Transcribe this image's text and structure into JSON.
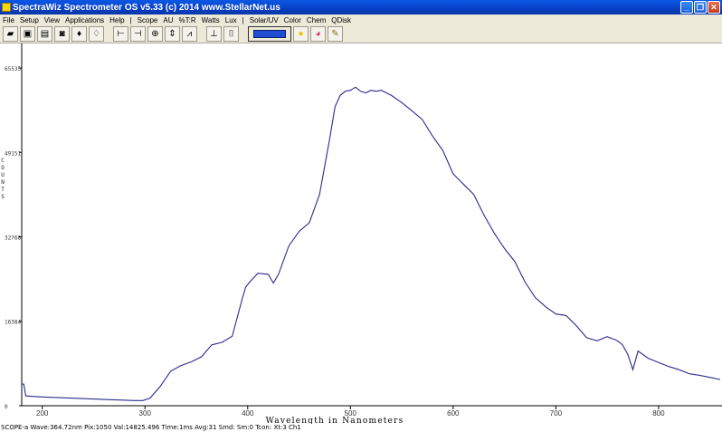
{
  "window": {
    "title": "SpectraWiz  Spectrometer OS v5.33 (c) 2014     www.StellarNet.us",
    "minimize_glyph": "_",
    "restore_glyph": "❐",
    "close_glyph": "✕"
  },
  "menu": {
    "items": [
      "File",
      "Setup",
      "View",
      "Applications",
      "Help",
      "|",
      "Scope",
      "AU",
      "%T:R",
      "Watts",
      "Lux",
      "|",
      "Solar/UV",
      "Color",
      "Chem",
      "QDisk"
    ]
  },
  "toolbar": {
    "buttons": [
      {
        "name": "open-icon",
        "glyph": "▰"
      },
      {
        "name": "save-icon",
        "glyph": "▣"
      },
      {
        "name": "print-icon",
        "glyph": "▤"
      },
      {
        "name": "camera-icon",
        "glyph": "◙"
      },
      {
        "name": "bulb-dark-icon",
        "glyph": "♦"
      },
      {
        "name": "bulb-light-icon",
        "glyph": "♢"
      },
      {
        "name": "cursor-left-icon",
        "glyph": "⊢"
      },
      {
        "name": "cursor-right-icon",
        "glyph": "⊣"
      },
      {
        "name": "zoom-icon",
        "glyph": "⊕"
      },
      {
        "name": "scale-icon",
        "glyph": "⇕"
      },
      {
        "name": "peak-icon",
        "glyph": "⩘"
      },
      {
        "name": "baseline-icon",
        "glyph": "⊥"
      },
      {
        "name": "scope-icon",
        "glyph": "⌷"
      }
    ],
    "accent_color": "#1f4fd0",
    "extra_buttons": [
      {
        "name": "yellow-circle-icon",
        "glyph": "●",
        "color": "#e7c400"
      },
      {
        "name": "color-wheel-icon",
        "glyph": "◕",
        "color": "#d0396d"
      },
      {
        "name": "paint-icon",
        "glyph": "✎",
        "color": "#8a6a1a"
      }
    ]
  },
  "chart_data": {
    "type": "line",
    "title": "",
    "xlabel": "Wavelength in Nanometers",
    "ylabel": "COUNTS",
    "xlim": [
      180,
      860
    ],
    "ylim": [
      0,
      65535
    ],
    "x_ticks": [
      200,
      300,
      400,
      500,
      600,
      700,
      800
    ],
    "y_ticks": [
      0,
      16384,
      32768,
      49151,
      65535
    ],
    "line_color": "#2b2b8f",
    "grid": false,
    "series": [
      {
        "x": [
          180,
          182,
          184,
          200,
          250,
          290,
          298,
          305,
          315,
          325,
          335,
          345,
          355,
          365,
          375,
          385,
          395,
          398,
          402,
          410,
          420,
          425,
          430,
          440,
          450,
          460,
          470,
          480,
          485,
          490,
          495,
          500,
          505,
          510,
          515,
          520,
          525,
          530,
          535,
          540,
          550,
          560,
          570,
          580,
          590,
          600,
          610,
          620,
          630,
          640,
          650,
          660,
          670,
          680,
          690,
          700,
          710,
          720,
          730,
          740,
          750,
          755,
          758,
          762,
          765,
          770,
          775,
          780,
          790,
          800,
          810,
          820,
          830,
          840,
          850,
          860
        ],
        "y": [
          4200,
          4200,
          1900,
          1700,
          1300,
          1000,
          1000,
          1500,
          3800,
          6700,
          7800,
          8500,
          9500,
          11800,
          12300,
          13500,
          21000,
          23000,
          24000,
          25700,
          25500,
          23800,
          25500,
          31000,
          33800,
          35500,
          41000,
          52000,
          58000,
          60200,
          61000,
          61200,
          61800,
          61000,
          60700,
          61200,
          61000,
          61200,
          60700,
          60200,
          58800,
          57200,
          55500,
          52300,
          49500,
          45000,
          43000,
          41000,
          37000,
          33500,
          30500,
          28000,
          24000,
          21000,
          19200,
          17800,
          17500,
          15500,
          13200,
          12600,
          13400,
          13000,
          12800,
          12300,
          11800,
          10000,
          7000,
          10600,
          9200,
          8400,
          7600,
          7000,
          6200,
          5900,
          5500,
          5100
        ]
      }
    ]
  },
  "status": {
    "text": "SCOPE-a  Wave:364.72nm  Pix:1050  Val:14825.496  Time:1ms  Avg:31  Smd:  Sm:0  Tcon:  Xt:3  Ch1"
  }
}
